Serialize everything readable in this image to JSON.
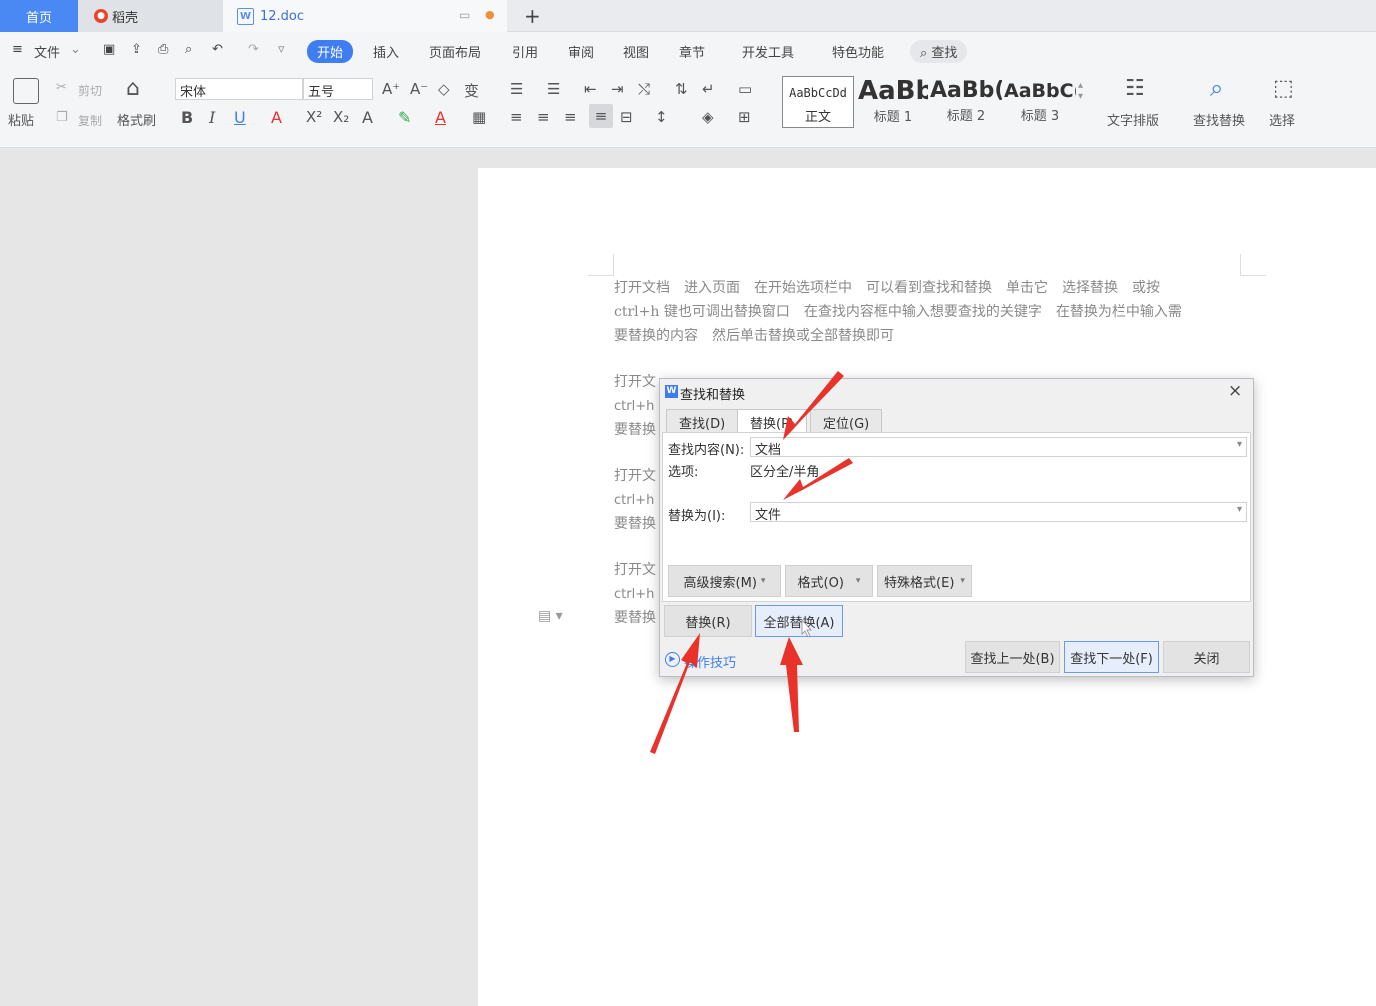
{
  "tabs": {
    "home": "首页",
    "daoke": "稻壳",
    "doc": "12.doc",
    "doc_icon": "W",
    "new_tab": "+"
  },
  "menu": {
    "file": "文件",
    "start": "开始",
    "insert": "插入",
    "layout": "页面布局",
    "reference": "引用",
    "review": "审阅",
    "view": "视图",
    "chapter": "章节",
    "devtools": "开发工具",
    "features": "特色功能",
    "search": "查找"
  },
  "ribbon": {
    "paste": "粘贴",
    "cut": "剪切",
    "copy": "复制",
    "format_painter": "格式刷",
    "font_name": "宋体",
    "font_size": "五号",
    "bold": "B",
    "italic": "I",
    "underline": "U",
    "styles": [
      {
        "preview": "AaBbCcDd",
        "name": "正文"
      },
      {
        "preview": "AaBb",
        "name": "标题 1"
      },
      {
        "preview": "AaBb(",
        "name": "标题 2"
      },
      {
        "preview": "AaBbC(",
        "name": "标题 3"
      }
    ],
    "text_layout": "文字排版",
    "find_replace": "查找替换",
    "select": "选择"
  },
  "document": {
    "para1": [
      "打开文档　进入页面　在开始选项栏中　可以看到查找和替换　单击它　选择替换　或按",
      "ctrl+h 键也可调出替换窗口　在查找内容框中输入想要查找的关键字　在替换为栏中输入需",
      "要替换的内容　然后单击替换或全部替换即可"
    ],
    "partial_lines": [
      "打开文",
      "ctrl+h",
      "要替换",
      "打开文",
      "ctrl+h",
      "要替换",
      "打开文",
      "ctrl+h",
      "要替换"
    ]
  },
  "dialog": {
    "title": "查找和替换",
    "tabs": [
      "查找(D)",
      "替换(P)",
      "定位(G)"
    ],
    "find_label": "查找内容(N):",
    "find_value": "文档",
    "options_label": "选项:",
    "options_value": "区分全/半角",
    "replace_label": "替换为(I):",
    "replace_value": "文件",
    "buttons": {
      "advanced": "高级搜索(M)",
      "format": "格式(O)",
      "special": "特殊格式(E)",
      "replace": "替换(R)",
      "replace_all": "全部替换(A)",
      "find_prev": "查找上一处(B)",
      "find_next": "查找下一处(F)",
      "close": "关闭"
    },
    "tips": "操作技巧"
  },
  "colors": {
    "accent": "#3f7ef2",
    "arrow": "#e8322a"
  }
}
